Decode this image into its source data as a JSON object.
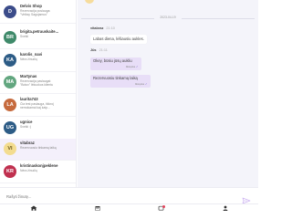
{
  "conversations": [
    {
      "initials": "D",
      "name": "Delvis Shop",
      "preview": "Rezervacija poslauga: \"Veiksy Sagojamus\"",
      "color": "#3b4c8a",
      "active": false
    },
    {
      "initials": "BR",
      "name": "brigita.petrauskaite...",
      "preview": "Sveiki",
      "color": "#3f8a6a",
      "active": false
    },
    {
      "initials": "KA",
      "name": "karolis_navi",
      "preview": "Nėra žinučių",
      "color": "#2d5c86",
      "active": false
    },
    {
      "initials": "MA",
      "name": "Martynas",
      "preview": "Rezervacija paslaugai: \"Botox\" lėkuokos klientu",
      "color": "#62a67f",
      "active": false
    },
    {
      "initials": "LA",
      "name": "laurita743",
      "preview": "Čia test paslauga, tikkroj nemokamai kaj kaip...",
      "color": "#c66a3d",
      "active": false
    },
    {
      "initials": "UG",
      "name": "ugnice",
      "preview": "Sveiki :)",
      "color": "#2d5c86",
      "active": false
    },
    {
      "initials": "VI",
      "name": "vitabraz",
      "preview": "Rezervuosiu tinkamą laiką",
      "color": "#f3dc8f",
      "active": true
    },
    {
      "initials": "KR",
      "name": "kristinaskonjpeklene",
      "preview": "Nėra žinučių",
      "color": "#c0304f",
      "active": false
    }
  ],
  "chat": {
    "date": "2023-04-19",
    "messages": [
      {
        "sender": "vitabraz",
        "time": "21:10",
        "text": "Labas diena, lėšiausiu aukles.",
        "mine": false,
        "status": ""
      },
      {
        "sender": "Jūs",
        "time": "21:11",
        "text": "Okey, būsiu jūsų aukliu",
        "mine": true,
        "status": "Išsiųsta"
      },
      {
        "sender": "",
        "time": "",
        "text": "Rezervuosiu tinkamą laiką",
        "mine": true,
        "status": "Išsiųsta"
      }
    ]
  },
  "input": {
    "placeholder": "Rašyti žinutę...",
    "value": ""
  },
  "nav": [
    {
      "icon": "home-icon",
      "name": "nav-home"
    },
    {
      "icon": "calendar-icon",
      "name": "nav-calendar"
    },
    {
      "icon": "chat-icon",
      "name": "nav-messages"
    },
    {
      "icon": "user-icon",
      "name": "nav-profile"
    }
  ],
  "colors": {
    "accent": "#7a5dc9",
    "bubble_mine": "#e8def7",
    "chat_bg": "#f4f4fa"
  }
}
